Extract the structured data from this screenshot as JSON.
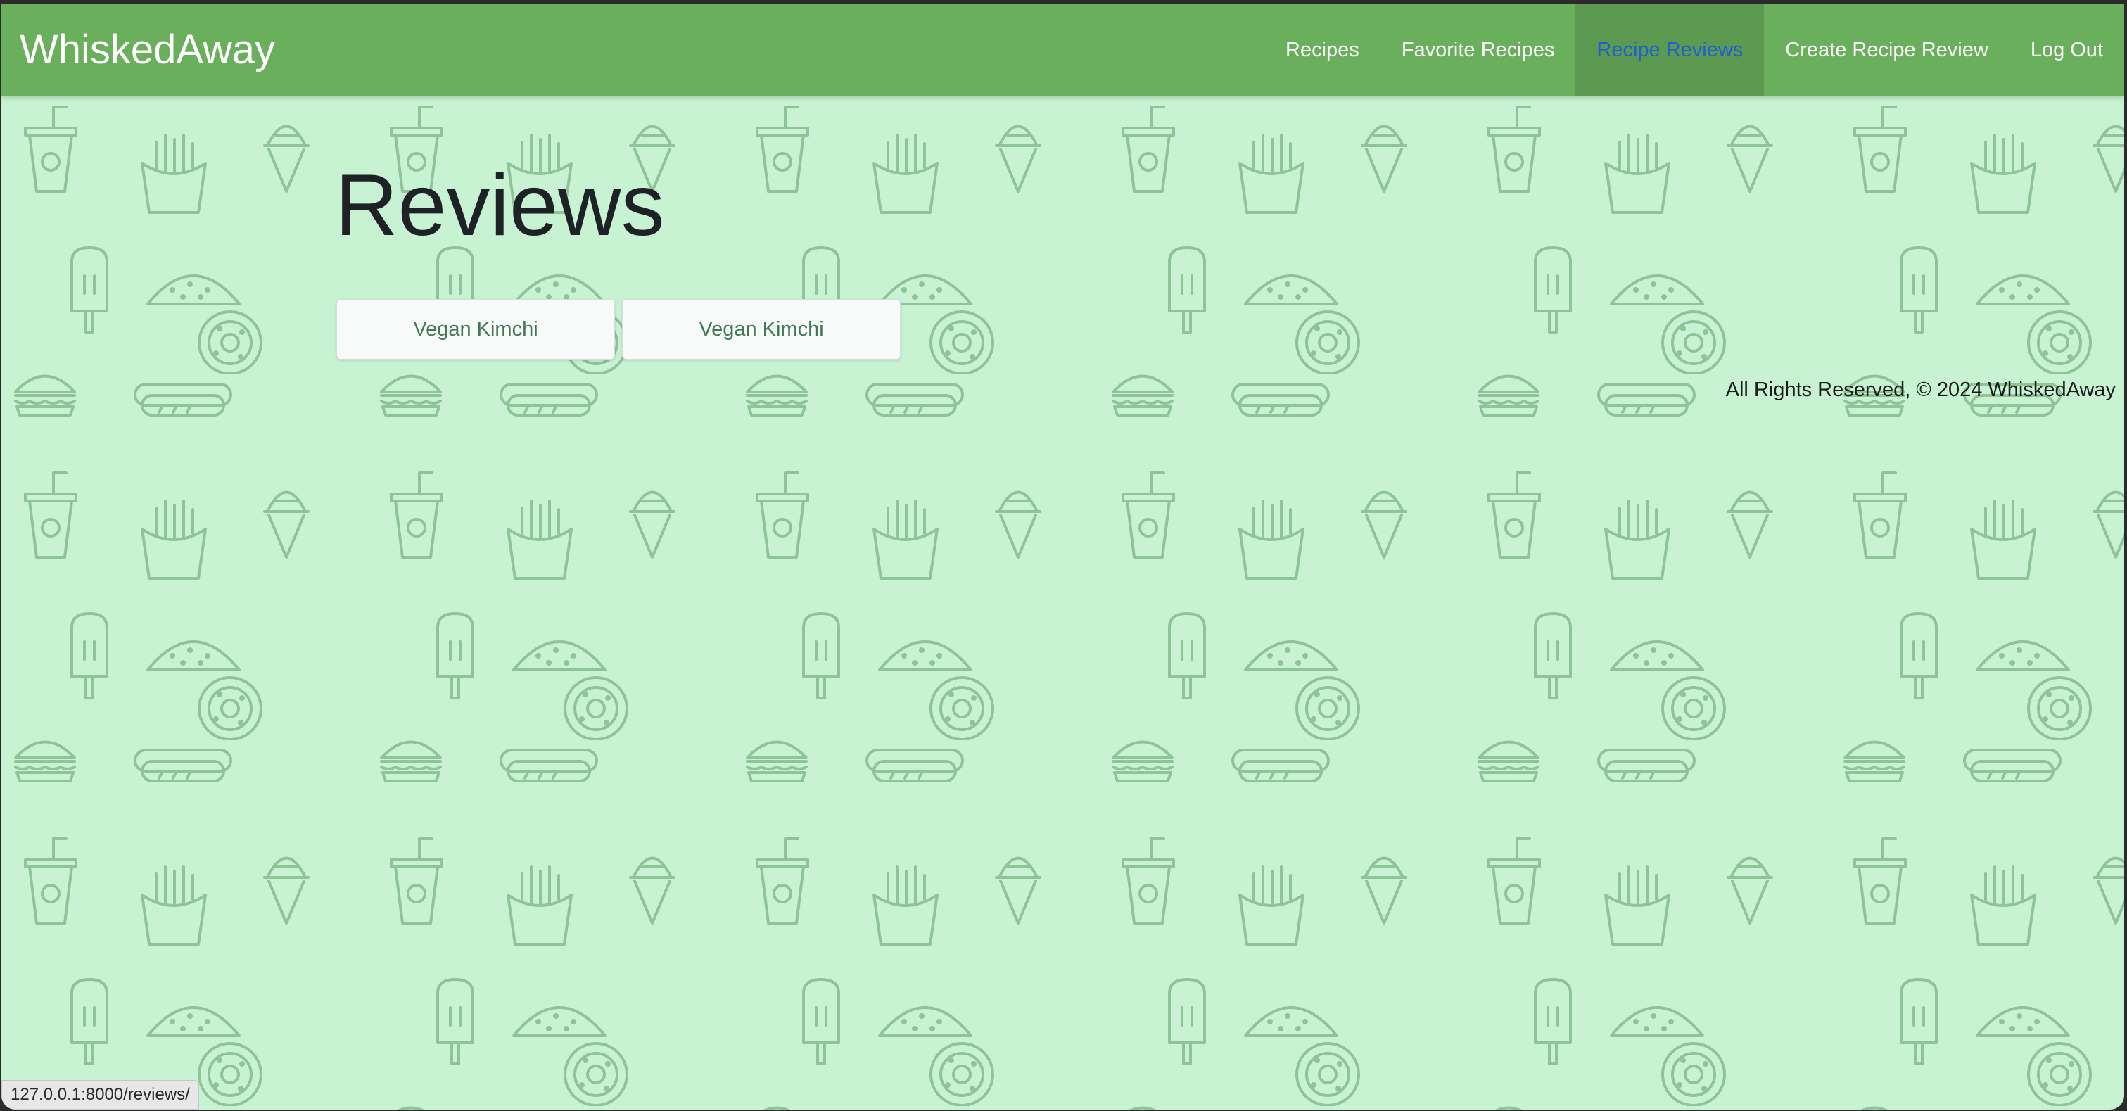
{
  "navbar": {
    "brand": "WhiskedAway",
    "items": [
      {
        "label": "Recipes",
        "active": false
      },
      {
        "label": "Favorite Recipes",
        "active": false
      },
      {
        "label": "Recipe Reviews",
        "active": true
      },
      {
        "label": "Create Recipe Review",
        "active": false
      },
      {
        "label": "Log Out",
        "active": false
      }
    ]
  },
  "main": {
    "title": "Reviews",
    "reviews": [
      {
        "label": "Vegan Kimchi"
      },
      {
        "label": "Vegan Kimchi"
      }
    ]
  },
  "footer": {
    "text": "All Rights Reserved, © 2024 WhiskedAway"
  },
  "status_bar": {
    "url": "127.0.0.1:8000/reviews/"
  },
  "colors": {
    "background": "#c7f3d3",
    "navbar": "#69af5c",
    "nav_active_bg": "#5c9a52",
    "nav_active_text": "#1e5fd4",
    "pattern_stroke": "#8fc398",
    "button_text": "#3f7a55"
  },
  "background_pattern_icons": [
    "drink-cup-icon",
    "fries-icon",
    "ice-cream-cone-icon",
    "taco-icon",
    "popsicle-icon",
    "donut-icon",
    "hot-dog-icon",
    "burger-icon"
  ]
}
